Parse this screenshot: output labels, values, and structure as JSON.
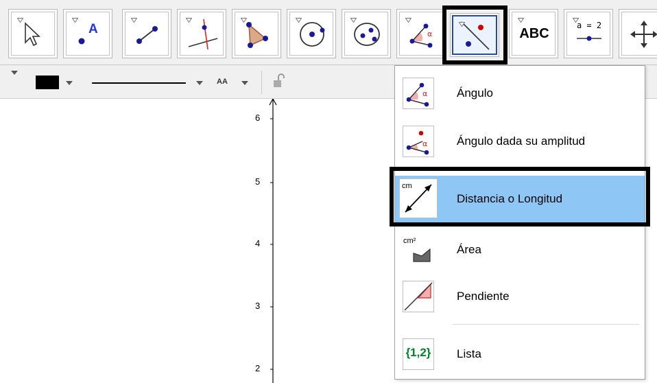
{
  "toolbar": {
    "tools": [
      {
        "name": "move-tool",
        "icon": "pointer-arrow-icon"
      },
      {
        "name": "point-tool",
        "icon": "point-A-icon",
        "label": "A"
      },
      {
        "name": "line-tool",
        "icon": "segment-icon"
      },
      {
        "name": "perpendicular-tool",
        "icon": "perpendicular-lines-icon"
      },
      {
        "name": "polygon-tool",
        "icon": "polygon-icon"
      },
      {
        "name": "circle-tool",
        "icon": "circle-center-icon"
      },
      {
        "name": "conic-tool",
        "icon": "ellipse-icon"
      },
      {
        "name": "angle-tool",
        "icon": "angle-icon",
        "symbol": "α"
      },
      {
        "name": "reflect-tool",
        "icon": "reflect-about-line-icon",
        "active": true
      },
      {
        "name": "text-tool",
        "icon": "text-icon",
        "label": "ABC"
      },
      {
        "name": "slider-tool",
        "icon": "slider-icon",
        "label": "a = 2"
      },
      {
        "name": "move-view-tool",
        "icon": "move-graphics-icon"
      }
    ]
  },
  "stylebar": {
    "color": "#000000",
    "font_size_label": "AA"
  },
  "axis": {
    "y_ticks": [
      "6",
      "5",
      "4",
      "3",
      "2"
    ]
  },
  "dropdown": {
    "items": [
      {
        "label": "Ángulo",
        "icon": "angle-icon",
        "symbol": "α"
      },
      {
        "label": "Ángulo dada su amplitud",
        "icon": "angle-given-size-icon",
        "symbol": "α"
      },
      {
        "label": "Distancia o Longitud",
        "icon": "distance-length-icon",
        "unit": "cm",
        "selected": true
      },
      {
        "label": "Área",
        "icon": "area-icon",
        "unit": "cm²"
      },
      {
        "label": "Pendiente",
        "icon": "slope-icon"
      },
      {
        "label": "Lista",
        "icon": "list-icon",
        "badge": "{1,2}"
      }
    ]
  },
  "colors": {
    "selected_bg": "#8ec7f5",
    "point_blue": "#1a1a99",
    "point_red": "#cc0000",
    "angle_fill": "#f4b0b0"
  }
}
